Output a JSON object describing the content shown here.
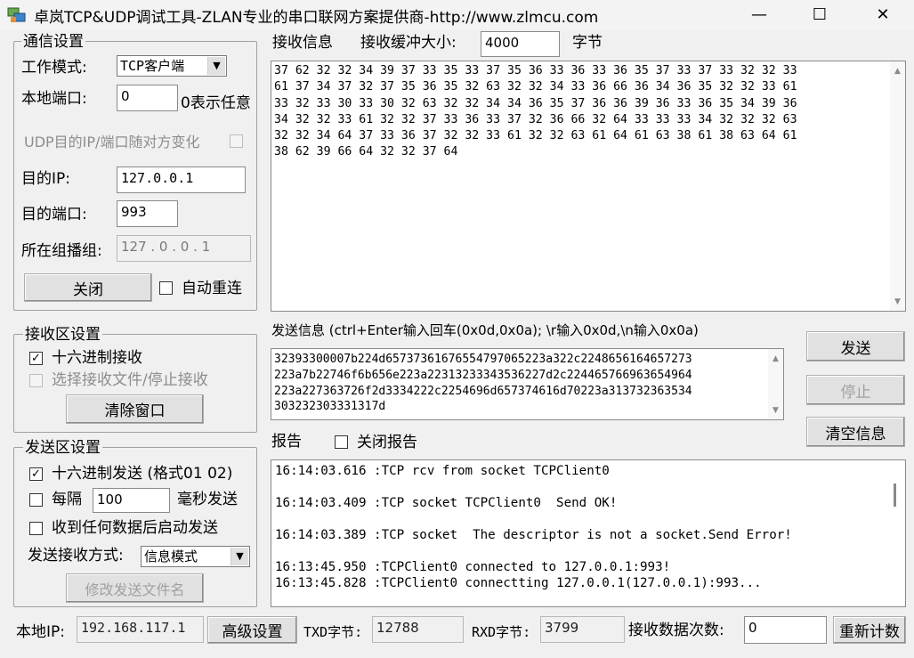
{
  "window": {
    "title": "卓岚TCP&UDP调试工具-ZLAN专业的串口联网方案提供商-http://www.zlmcu.com",
    "minimize": "—",
    "maximize": "☐",
    "close": "✕"
  },
  "comm": {
    "group_title": "通信设置",
    "mode_label": "工作模式:",
    "mode_value": "TCP客户端",
    "local_port_label": "本地端口:",
    "local_port_value": "0",
    "local_port_hint": "0表示任意",
    "udp_follow_label": "UDP目的IP/端口随对方变化",
    "dest_ip_label": "目的IP:",
    "dest_ip_value": "127.0.0.1",
    "dest_port_label": "目的端口:",
    "dest_port_value": "993",
    "multicast_label": "所在组播组:",
    "multicast_value": "127 . 0  . 0  . 1",
    "close_button": "关闭",
    "auto_reconnect_label": "自动重连"
  },
  "recv_settings": {
    "group_title": "接收区设置",
    "hex_recv_label": "十六进制接收",
    "hex_recv_checked": true,
    "select_file_label": "选择接收文件/停止接收",
    "clear_button": "清除窗口"
  },
  "send_settings": {
    "group_title": "发送区设置",
    "hex_send_label": "十六进制发送 (格式01 02)",
    "hex_send_checked": true,
    "every_label": "每隔",
    "interval_value": "100",
    "ms_label": "毫秒发送",
    "send_on_recv_label": "收到任何数据后启动发送",
    "mode_label": "发送接收方式:",
    "mode_value": "信息模式",
    "modify_file_button": "修改发送文件名"
  },
  "recv": {
    "label": "接收信息",
    "buffer_label": "接收缓冲大小:",
    "buffer_value": "4000",
    "unit": "字节",
    "lines": [
      "37 62 32 32 34 39 37 33 35 33 37 35 36 33 36 33 36 35 37 33 37 33 32 32 33",
      "61 37 34 37 32 37 35 36 35 32 63 32 32 34 33 36 66 36 34 36 35 32 32 33 61",
      "33 32 33 30 33 30 32 63 32 32 34 34 36 35 37 36 36 39 36 33 36 35 34 39 36",
      "34 32 32 33 61 32 32 37 33 36 33 37 32 36 66 32 64 33 33 33 34 32 32 32 63",
      "32 32 34 64 37 33 36 37 32 32 33 61 32 32 63 61 64 61 63 38 61 38 63 64 61",
      "38 62 39 66 64 32 32 37 64"
    ]
  },
  "send": {
    "label": "发送信息 (ctrl+Enter输入回车(0x0d,0x0a); \\r输入0x0d,\\n输入0x0a)",
    "lines": [
      "32393300007b224d65737361676554797065223a322c2248656164657273",
      "223a7b22746f6b656e223a22313233343536227d2c224465766963654964",
      "223a227363726f2d3334222c2254696d657374616d70223a313732363534",
      "303232303331317d"
    ],
    "send_button": "发送",
    "stop_button": "停止",
    "clear_button": "清空信息"
  },
  "report": {
    "label": "报告",
    "close_report_label": "关闭报告",
    "lines": [
      "16:14:03.616 :TCP rcv from socket TCPClient0",
      "16:14:03.409 :TCP socket TCPClient0  Send OK!",
      "16:14:03.389 :TCP socket  The descriptor is not a socket.Send Error!",
      "16:13:45.950 :TCPClient0 connected to 127.0.0.1:993!",
      "16:13:45.828 :TCPClient0 connectting 127.0.0.1(127.0.0.1):993..."
    ]
  },
  "status": {
    "local_ip_label": "本地IP:",
    "local_ip_value": "192.168.117.1",
    "advanced_button": "高级设置",
    "txd_label": "TXD字节:",
    "txd_value": "12788",
    "rxd_label": "RXD字节:",
    "rxd_value": "3799",
    "recv_count_label": "接收数据次数:",
    "recv_count_value": "0",
    "recount_button": "重新计数"
  }
}
